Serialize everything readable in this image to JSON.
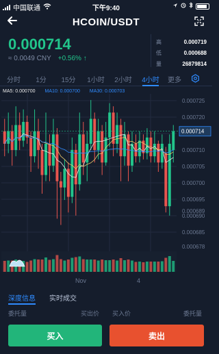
{
  "status_bar": {
    "carrier": "中国联通",
    "time": "下午9:40"
  },
  "nav": {
    "title": "HCOIN/USDT"
  },
  "ticker": {
    "price": "0.000714",
    "cny": "≈ 0.0049 CNY",
    "change": "+0.56%",
    "high_label": "高",
    "high_value": "0.000719",
    "low_label": "低",
    "low_value": "0.000688",
    "volume_label": "量",
    "volume_value": "26879814"
  },
  "tabs": [
    {
      "label": "分时"
    },
    {
      "label": "1分"
    },
    {
      "label": "15分"
    },
    {
      "label": "1小时"
    },
    {
      "label": "2小时"
    },
    {
      "label": "4小时",
      "active": true
    },
    {
      "label": "更多"
    }
  ],
  "indicators": {
    "ma5": "MA5: 0.000700",
    "ma10": "MA10: 0.000700",
    "ma30": "MA30: 0.000703"
  },
  "bottom_tabs": {
    "depth": "深度信息",
    "trades": "实时成交"
  },
  "columns": {
    "buy_volume": "委托量",
    "buy_price": "买出价",
    "sell_price": "买入价",
    "sell_volume": "委托量"
  },
  "actions": {
    "buy": "买入",
    "sell": "卖出"
  },
  "colors": {
    "up": "#22c58b",
    "down": "#e8554e",
    "accent": "#2f8bff",
    "background": "#151d2c"
  },
  "chart_data": {
    "type": "candlestick",
    "y_ticks": [
      "0.000725",
      "0.000720",
      "0.000715",
      "0.000710",
      "0.000705",
      "0.000700",
      "0.000695",
      "0.000690",
      "0.000685"
    ],
    "y_extra_ticks": [
      "0.000689",
      "0.000678"
    ],
    "current_price_label": "0.000714",
    "x_ticks": [
      "Nov",
      "4"
    ],
    "ylim": [
      0.000678,
      0.000728
    ],
    "candles": [
      {
        "o": 0.000716,
        "c": 0.000712,
        "h": 0.00072,
        "l": 0.000708
      },
      {
        "o": 0.000712,
        "c": 0.000716,
        "h": 0.000722,
        "l": 0.000709
      },
      {
        "o": 0.000716,
        "c": 0.00071,
        "h": 0.000718,
        "l": 0.000705
      },
      {
        "o": 0.00071,
        "c": 0.000718,
        "h": 0.000724,
        "l": 0.000708
      },
      {
        "o": 0.000718,
        "c": 0.000713,
        "h": 0.000722,
        "l": 0.00071
      },
      {
        "o": 0.000713,
        "c": 0.000719,
        "h": 0.000723,
        "l": 0.000711
      },
      {
        "o": 0.000719,
        "c": 0.000714,
        "h": 0.000721,
        "l": 0.000712
      },
      {
        "o": 0.000714,
        "c": 0.000708,
        "h": 0.000716,
        "l": 0.000703
      },
      {
        "o": 0.000708,
        "c": 0.000716,
        "h": 0.000723,
        "l": 0.000706
      },
      {
        "o": 0.000716,
        "c": 0.00071,
        "h": 0.00072,
        "l": 0.000704
      },
      {
        "o": 0.00071,
        "c": 0.000702,
        "h": 0.000712,
        "l": 0.000696
      },
      {
        "o": 0.000702,
        "c": 0.000712,
        "h": 0.000722,
        "l": 0.0007
      },
      {
        "o": 0.000712,
        "c": 0.000705,
        "h": 0.000715,
        "l": 0.0007
      },
      {
        "o": 0.000705,
        "c": 0.000715,
        "h": 0.00072,
        "l": 0.000703
      },
      {
        "o": 0.000715,
        "c": 0.0007,
        "h": 0.000717,
        "l": 0.000688
      },
      {
        "o": 0.0007,
        "c": 0.000698,
        "h": 0.000703,
        "l": 0.000686
      },
      {
        "o": 0.000698,
        "c": 0.000704,
        "h": 0.000707,
        "l": 0.000694
      },
      {
        "o": 0.000704,
        "c": 0.000695,
        "h": 0.000706,
        "l": 0.00069
      },
      {
        "o": 0.000695,
        "c": 0.00071,
        "h": 0.000714,
        "l": 0.000693
      },
      {
        "o": 0.00071,
        "c": 0.000699,
        "h": 0.000712,
        "l": 0.000689
      },
      {
        "o": 0.000699,
        "c": 0.000715,
        "h": 0.000722,
        "l": 0.000697
      },
      {
        "o": 0.000715,
        "c": 0.000706,
        "h": 0.000719,
        "l": 0.000702
      },
      {
        "o": 0.000706,
        "c": 0.000712,
        "h": 0.000716,
        "l": 0.0007
      },
      {
        "o": 0.000712,
        "c": 0.00072,
        "h": 0.000726,
        "l": 0.00071
      },
      {
        "o": 0.00072,
        "c": 0.00071,
        "h": 0.000722,
        "l": 0.000706
      },
      {
        "o": 0.00071,
        "c": 0.000716,
        "h": 0.00072,
        "l": 0.000707
      },
      {
        "o": 0.000716,
        "c": 0.000706,
        "h": 0.000718,
        "l": 0.000702
      },
      {
        "o": 0.000706,
        "c": 0.000714,
        "h": 0.000719,
        "l": 0.000705
      },
      {
        "o": 0.000714,
        "c": 0.000722,
        "h": 0.000725,
        "l": 0.000711
      },
      {
        "o": 0.000722,
        "c": 0.000712,
        "h": 0.000724,
        "l": 0.000708
      },
      {
        "o": 0.000712,
        "c": 0.000718,
        "h": 0.000722,
        "l": 0.000709
      },
      {
        "o": 0.000718,
        "c": 0.000708,
        "h": 0.00072,
        "l": 0.0007
      },
      {
        "o": 0.000708,
        "c": 0.000715,
        "h": 0.000719,
        "l": 0.000705
      },
      {
        "o": 0.000715,
        "c": 0.000705,
        "h": 0.000716,
        "l": 0.0007
      },
      {
        "o": 0.000705,
        "c": 0.000712,
        "h": 0.000716,
        "l": 0.000703
      },
      {
        "o": 0.000712,
        "c": 0.000708,
        "h": 0.000715,
        "l": 0.000706
      },
      {
        "o": 0.000708,
        "c": 0.000713,
        "h": 0.000716,
        "l": 0.000706
      },
      {
        "o": 0.000713,
        "c": 0.000709,
        "h": 0.000715,
        "l": 0.000707
      },
      {
        "o": 0.000709,
        "c": 0.000714,
        "h": 0.000717,
        "l": 0.000707
      },
      {
        "o": 0.000714,
        "c": 0.000708,
        "h": 0.000716,
        "l": 0.000706
      },
      {
        "o": 0.000708,
        "c": 0.000712,
        "h": 0.000716,
        "l": 0.000706
      },
      {
        "o": 0.000712,
        "c": 0.000706,
        "h": 0.000713,
        "l": 0.000703
      },
      {
        "o": 0.000706,
        "c": 0.000712,
        "h": 0.000715,
        "l": 0.000704
      },
      {
        "o": 0.000709,
        "c": 0.000692,
        "h": 0.000711,
        "l": 0.00069
      },
      {
        "o": 0.000692,
        "c": 0.000712,
        "h": 0.000715,
        "l": 0.000689
      },
      {
        "o": 0.00071,
        "c": 0.000716,
        "h": 0.000718,
        "l": 0.000706
      }
    ]
  }
}
